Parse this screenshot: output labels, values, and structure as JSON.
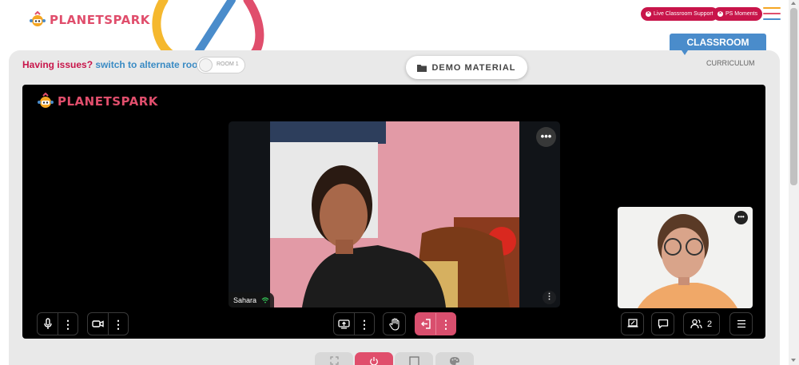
{
  "brand": {
    "logo_text": "PLANETSPARK",
    "colors": {
      "primary_red": "#c8154a",
      "blue": "#4a8ccb",
      "orange": "#f5a623",
      "pink": "#e04e6c"
    }
  },
  "header": {
    "live_support_label": "Live Classroom Support",
    "ps_moments_label": "PS Moments",
    "menu_icon": "hamburger-icon"
  },
  "tabs": {
    "classroom_label": "CLASSROOM",
    "curriculum_label": "CURRICULUM"
  },
  "toolbar": {
    "issues_label": "Having issues?",
    "switch_label": "switch to alternate room",
    "room_toggle_label": "ROOM 1",
    "demo_material_label": "DEMO MATERIAL"
  },
  "participants": {
    "main_name": "Sahara",
    "count": "2"
  },
  "controls": {
    "icons": [
      "microphone-icon",
      "video-camera-icon",
      "screen-share-icon",
      "raise-hand-icon",
      "exit-class-icon",
      "whiteboard-icon",
      "chat-icon",
      "participants-icon",
      "list-menu-icon"
    ]
  },
  "bottom_bar": {
    "icons": [
      "fullscreen-icon",
      "power-icon",
      "square-icon",
      "palette-icon"
    ]
  }
}
